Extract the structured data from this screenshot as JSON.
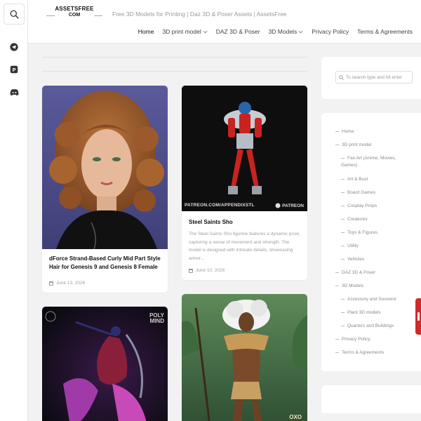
{
  "site": {
    "logo_line1": "ASSETSFREE",
    "logo_line2": "COM",
    "tagline": "Free 3D Models for Printing | Daz 3D & Poser Assets | AssetsFree"
  },
  "rail": {
    "search_icon": "search-icon",
    "socials": [
      "telegram-icon",
      "pinterest-icon",
      "discord-icon"
    ]
  },
  "nav": {
    "items": [
      {
        "label": "Home",
        "active": true,
        "dropdown": false
      },
      {
        "label": "3D print model",
        "active": false,
        "dropdown": true
      },
      {
        "label": "DAZ 3D & Poser",
        "active": false,
        "dropdown": false
      },
      {
        "label": "3D Models",
        "active": false,
        "dropdown": true
      },
      {
        "label": "Privacy Policy",
        "active": false,
        "dropdown": false
      },
      {
        "label": "Terms & Agreements",
        "active": false,
        "dropdown": false
      }
    ]
  },
  "posts": [
    {
      "title": "dForce Strand-Based Curly Mid Part Style Hair for Genesis 9 and Genesis 8 Female",
      "excerpt": "",
      "date": "June 13, 2026"
    },
    {
      "title": "Steel Saints Sho",
      "excerpt": "The Steel Saints Sho figurine features a dynamic pose, capturing a sense of movement and strength. The model is designed with intricate details, showcasing armor...",
      "date": "June 10, 2026",
      "watermark": "PATREON.COM/APPENDIXSTL",
      "watermark_brand": "PATREON"
    },
    {
      "title": "",
      "watermark": "POLY MIND"
    },
    {
      "title": "",
      "watermark": "OXO"
    }
  ],
  "sidebar": {
    "search_placeholder": "To search type and hit enter",
    "menu": [
      {
        "label": "Home",
        "level": 0
      },
      {
        "label": "3D print model",
        "level": 0
      },
      {
        "label": "Fan Art (Anime, Movies, Games)",
        "level": 1
      },
      {
        "label": "Art & Bust",
        "level": 1
      },
      {
        "label": "Board Games",
        "level": 1
      },
      {
        "label": "Cosplay Props",
        "level": 1
      },
      {
        "label": "Creatures",
        "level": 1
      },
      {
        "label": "Toys & Figures",
        "level": 1
      },
      {
        "label": "Utility",
        "level": 1
      },
      {
        "label": "Vehicles",
        "level": 1
      },
      {
        "label": "DAZ 3D & Poser",
        "level": 0
      },
      {
        "label": "3D Models",
        "level": 0
      },
      {
        "label": "Accessory and Souvenir",
        "level": 1
      },
      {
        "label": "Plant 3D models",
        "level": 1
      },
      {
        "label": "Quarters and Buildings",
        "level": 1
      },
      {
        "label": "Privacy Policy",
        "level": 0
      },
      {
        "label": "Terms & Agreements",
        "level": 0
      }
    ]
  },
  "colors": {
    "background": "#f2f2f2",
    "card": "#ffffff",
    "muted_text": "#a0a0a0",
    "accent_red": "#d12a2a"
  }
}
